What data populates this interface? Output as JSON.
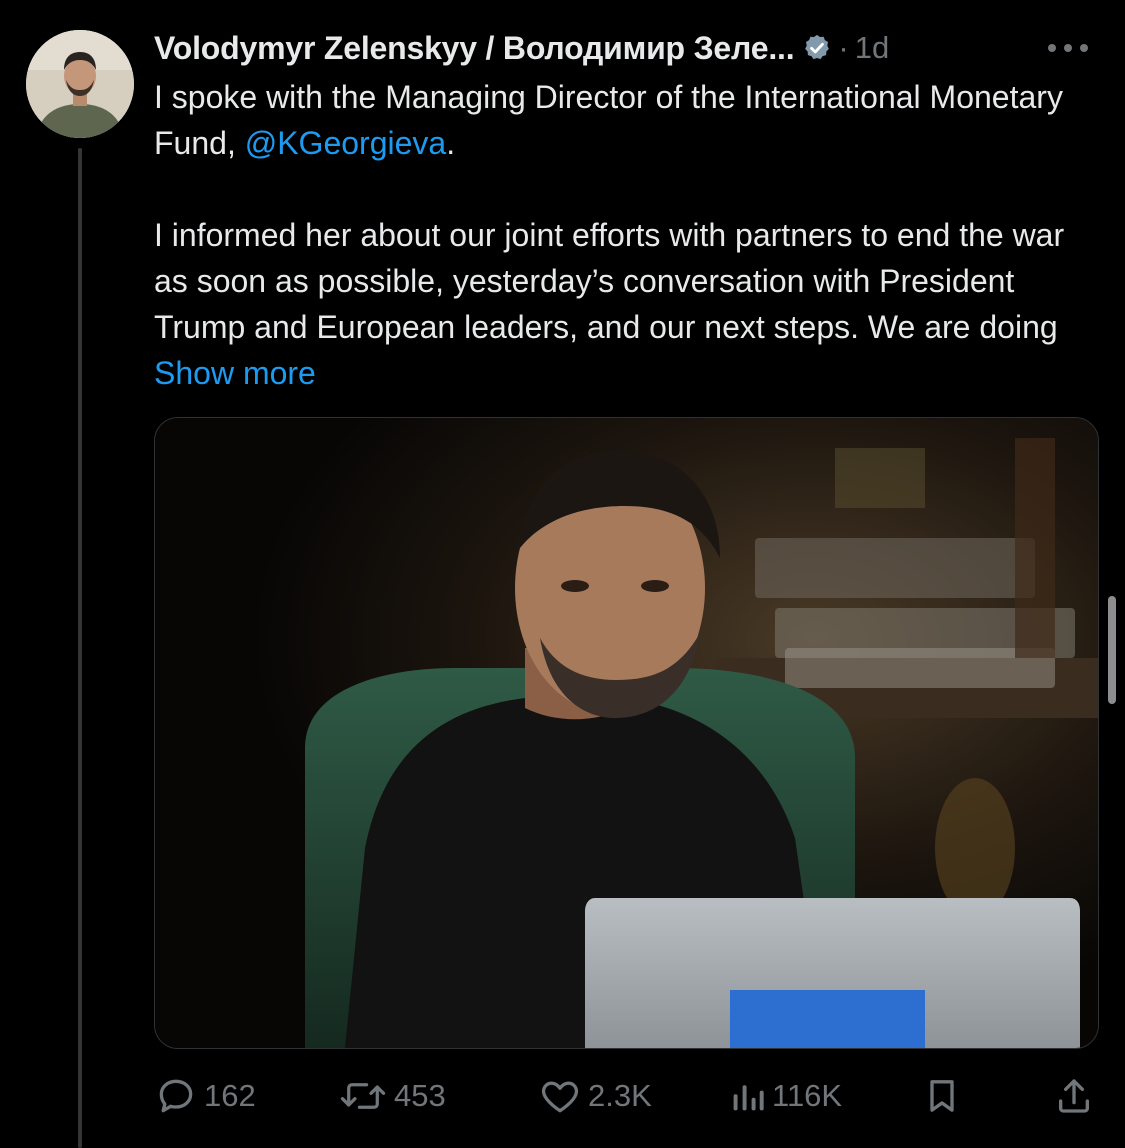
{
  "tweet": {
    "author": {
      "display_name": "Volodymyr Zelenskyy / Володимир Зеле...",
      "verified_icon": "verified-badge-icon",
      "time_separator": "·",
      "time": "1d"
    },
    "text": {
      "p1_part1": "I spoke with the Managing Director of the International Monetary Fund, ",
      "mention": "@KGeorgieva",
      "p1_part2": ".",
      "p2_part1": "I informed her about our joint efforts with partners to end the war as soon as possible, yesterday’s conversation with President Trump and European leaders, and our next steps. We are doing ",
      "show_more": "Show more"
    },
    "media": {
      "description_icon": "photo"
    },
    "actions": {
      "replies": "162",
      "reposts": "453",
      "likes": "2.3K",
      "views": "116K"
    }
  },
  "colors": {
    "background": "#000000",
    "text": "#e7e9ea",
    "secondary": "#71767b",
    "accent": "#1d9bf0"
  }
}
